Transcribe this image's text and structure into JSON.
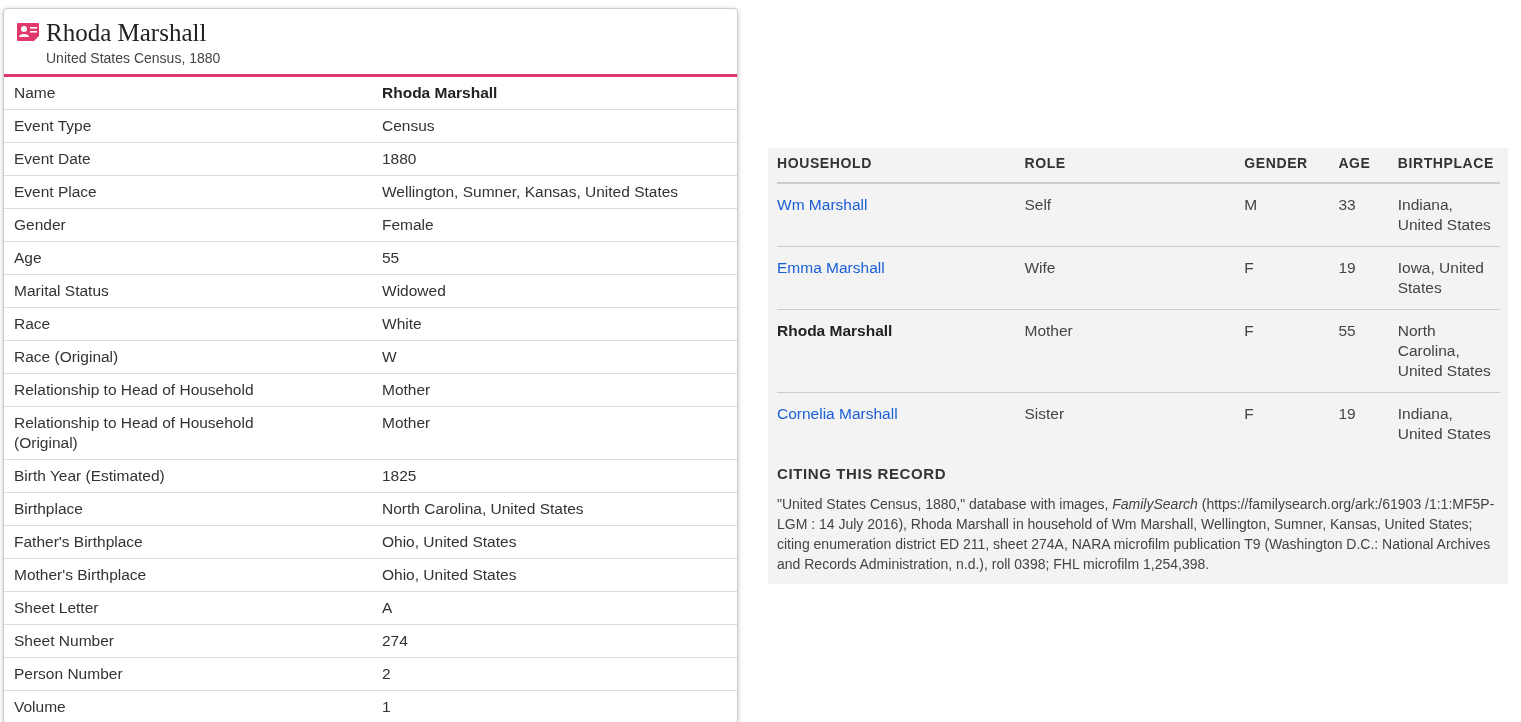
{
  "record": {
    "title": "Rhoda Marshall",
    "subtitle": "United States Census, 1880",
    "fields": [
      {
        "label": "Name",
        "value": "Rhoda Marshall",
        "bold": true
      },
      {
        "label": "Event Type",
        "value": "Census",
        "bold": false
      },
      {
        "label": "Event Date",
        "value": "1880",
        "bold": false
      },
      {
        "label": "Event Place",
        "value": "Wellington, Sumner, Kansas, United States",
        "bold": false
      },
      {
        "label": "Gender",
        "value": "Female",
        "bold": false
      },
      {
        "label": "Age",
        "value": "55",
        "bold": false
      },
      {
        "label": "Marital Status",
        "value": "Widowed",
        "bold": false
      },
      {
        "label": "Race",
        "value": "White",
        "bold": false
      },
      {
        "label": "Race (Original)",
        "value": "W",
        "bold": false
      },
      {
        "label": "Relationship to Head of Household",
        "value": "Mother",
        "bold": false
      },
      {
        "label": "Relationship to Head of Household (Original)",
        "value": "Mother",
        "bold": false
      },
      {
        "label": "Birth Year (Estimated)",
        "value": "1825",
        "bold": false
      },
      {
        "label": "Birthplace",
        "value": "North Carolina, United States",
        "bold": false
      },
      {
        "label": "Father's Birthplace",
        "value": "Ohio, United States",
        "bold": false
      },
      {
        "label": "Mother's Birthplace",
        "value": "Ohio, United States",
        "bold": false
      },
      {
        "label": "Sheet Letter",
        "value": "A",
        "bold": false
      },
      {
        "label": "Sheet Number",
        "value": "274",
        "bold": false
      },
      {
        "label": "Person Number",
        "value": "2",
        "bold": false
      },
      {
        "label": "Volume",
        "value": "1",
        "bold": false
      }
    ]
  },
  "household": {
    "columns": [
      "HOUSEHOLD",
      "ROLE",
      "GENDER",
      "AGE",
      "BIRTHPLACE"
    ],
    "rows": [
      {
        "kind": "link",
        "name": "Wm Marshall",
        "role": "Self",
        "gender": "M",
        "age": "33",
        "birthplace": "Indiana, United States"
      },
      {
        "kind": "link",
        "name": "Emma Marshall",
        "role": "Wife",
        "gender": "F",
        "age": "19",
        "birthplace": "Iowa, United States"
      },
      {
        "kind": "current",
        "name": "Rhoda Marshall",
        "role": "Mother",
        "gender": "F",
        "age": "55",
        "birthplace": "North Carolina, United States"
      },
      {
        "kind": "link",
        "name": "Cornelia Marshall",
        "role": "Sister",
        "gender": "F",
        "age": "19",
        "birthplace": "Indiana, United States"
      }
    ]
  },
  "citation": {
    "heading": "CITING THIS RECORD",
    "text": "\"United States Census, 1880,\" database with images, *FamilySearch* (https://familysearch.org/ark:/61903 /1:1:MF5P-LGM : 14 July 2016), Rhoda Marshall in household of Wm Marshall, Wellington, Sumner, Kansas, United States; citing enumeration district ED 211, sheet 274A, NARA microfilm publication T9 (Washington D.C.: National Archives and Records Administration, n.d.), roll 0398; FHL microfilm 1,254,398."
  }
}
